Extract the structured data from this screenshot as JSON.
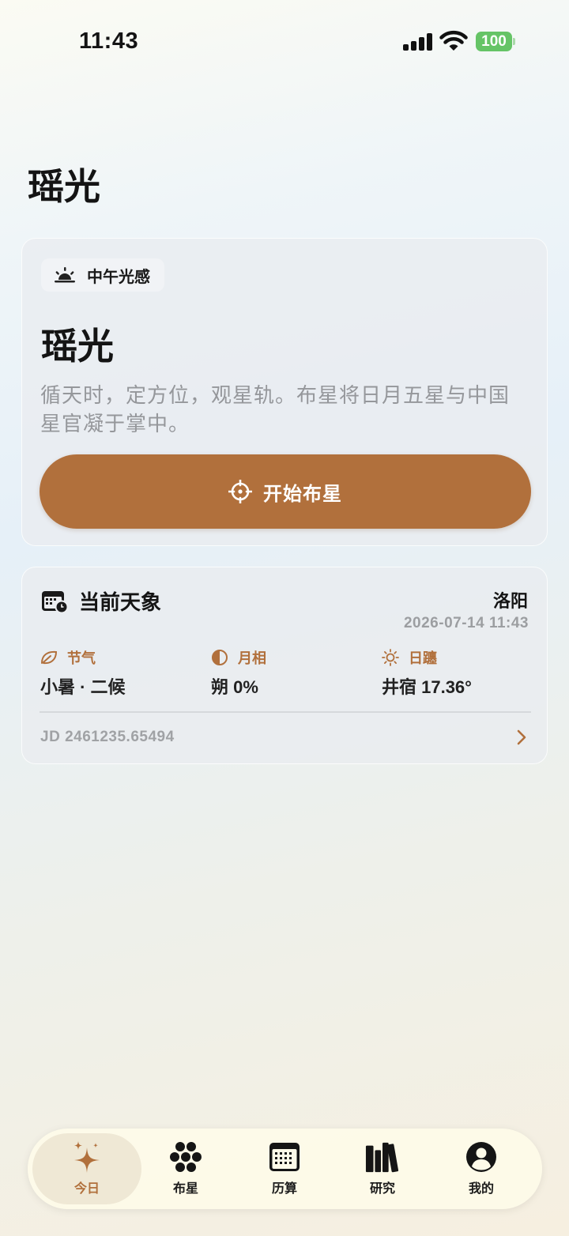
{
  "status_bar": {
    "time": "11:43",
    "battery": "100"
  },
  "page": {
    "title": "瑶光"
  },
  "hero": {
    "chip_label": "中午光感",
    "title": "瑶光",
    "description": "循天时，定方位，观星轨。布星将日月五星与中国星官凝于掌中。",
    "start_button_label": "开始布星"
  },
  "sky": {
    "title": "当前天象",
    "location": "洛阳",
    "datetime": "2026-07-14 11:43",
    "metrics": [
      {
        "label": "节气",
        "value": "小暑 · 二候",
        "icon": "leaf-icon"
      },
      {
        "label": "月相",
        "value": "朔 0%",
        "icon": "moon-phase-icon"
      },
      {
        "label": "日躔",
        "value": "井宿 17.36°",
        "icon": "sun-icon"
      }
    ],
    "julian_date": "JD 2461235.65494"
  },
  "tabs": [
    {
      "label": "今日",
      "icon": "sparkle-icon",
      "active": true
    },
    {
      "label": "布星",
      "icon": "star-cluster-icon",
      "active": false
    },
    {
      "label": "历算",
      "icon": "calendar-icon",
      "active": false
    },
    {
      "label": "研究",
      "icon": "books-icon",
      "active": false
    },
    {
      "label": "我的",
      "icon": "profile-icon",
      "active": false
    }
  ],
  "colors": {
    "accent": "#b1703c",
    "battery": "#65c466"
  }
}
